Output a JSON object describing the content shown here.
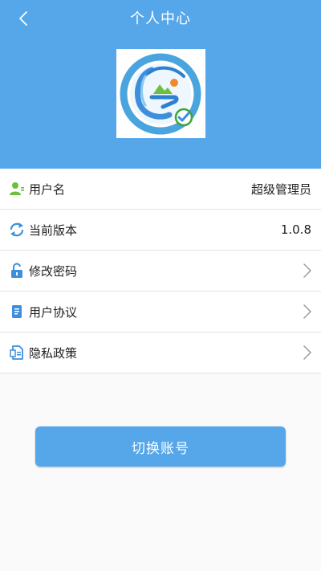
{
  "header": {
    "title": "个人中心",
    "back_icon": "chevron-left-icon",
    "background_color": "#56a7ea",
    "logo_icon": "app-logo-g-icon"
  },
  "list": {
    "items": [
      {
        "icon": "user-icon",
        "label": "用户名",
        "value": "超级管理员",
        "has_chevron": false
      },
      {
        "icon": "refresh-icon",
        "label": "当前版本",
        "value": "1.0.8",
        "has_chevron": false
      },
      {
        "icon": "unlock-icon",
        "label": "修改密码",
        "value": "",
        "has_chevron": true
      },
      {
        "icon": "document-icon",
        "label": "用户协议",
        "value": "",
        "has_chevron": true
      },
      {
        "icon": "policy-icon",
        "label": "隐私政策",
        "value": "",
        "has_chevron": true
      }
    ]
  },
  "button": {
    "label": "切换账号",
    "color": "#56a7ea"
  },
  "colors": {
    "icon_green": "#6cbf3f",
    "icon_blue": "#3d8fdc",
    "divider": "#e3e3e3"
  }
}
